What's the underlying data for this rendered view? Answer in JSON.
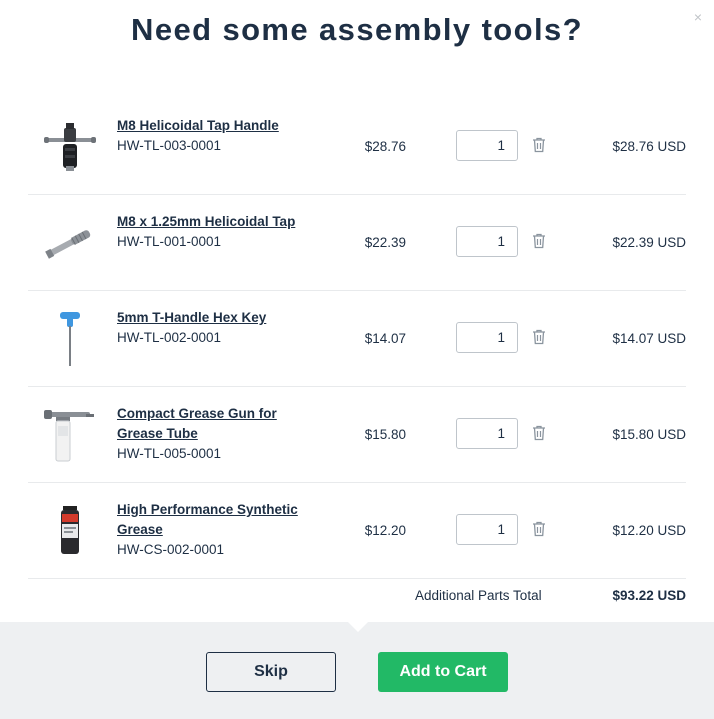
{
  "modal": {
    "title": "Need some assembly tools?",
    "close_label": "×"
  },
  "items": [
    {
      "name": "M8 Helicoidal Tap Handle",
      "sku": "HW-TL-003-0001",
      "price": "$28.76",
      "qty": "1",
      "total": "$28.76 USD",
      "icon": "tap-handle-image"
    },
    {
      "name": "M8 x 1.25mm Helicoidal Tap",
      "sku": "HW-TL-001-0001",
      "price": "$22.39",
      "qty": "1",
      "total": "$22.39 USD",
      "icon": "tap-image"
    },
    {
      "name": "5mm T-Handle Hex Key",
      "sku": "HW-TL-002-0001",
      "price": "$14.07",
      "qty": "1",
      "total": "$14.07 USD",
      "icon": "hex-key-image"
    },
    {
      "name": "Compact Grease Gun for Grease Tube",
      "sku": "HW-TL-005-0001",
      "price": "$15.80",
      "qty": "1",
      "total": "$15.80 USD",
      "icon": "grease-gun-image"
    },
    {
      "name": "High Performance Synthetic Grease",
      "sku": "HW-CS-002-0001",
      "price": "$12.20",
      "qty": "1",
      "total": "$12.20 USD",
      "icon": "grease-tube-image"
    }
  ],
  "summary": {
    "label": "Additional Parts Total",
    "value": "$93.22 USD"
  },
  "footer": {
    "skip_label": "Skip",
    "add_label": "Add to Cart"
  },
  "colors": {
    "accent_green": "#22b966",
    "text_dark": "#1e2f44",
    "footer_bg": "#eef0f2"
  }
}
